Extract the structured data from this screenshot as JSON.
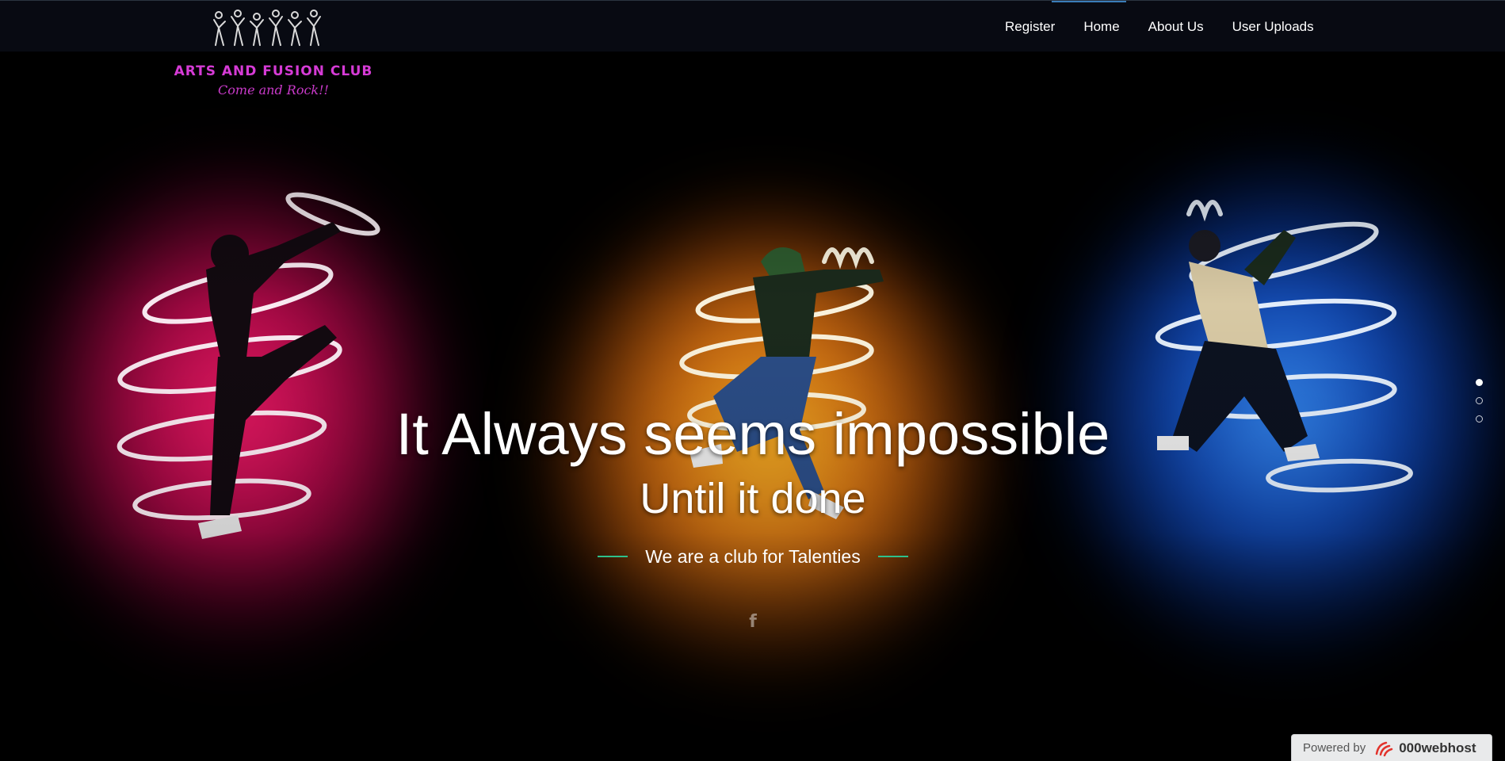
{
  "brand": {
    "title": "ARTS AND FUSION CLUB",
    "subtitle": "Come and Rock!!"
  },
  "nav": {
    "items": [
      {
        "label": "Register"
      },
      {
        "label": "Home"
      },
      {
        "label": "About Us"
      },
      {
        "label": "User Uploads"
      }
    ],
    "active": "Home"
  },
  "hero": {
    "line1": "It Always seems impossible",
    "line2": "Until it done",
    "tagline": "We are a club for Talenties",
    "social_icon": "f"
  },
  "slider": {
    "slides": 3,
    "active_index": 0
  },
  "footer_badge": {
    "label": "Powered by",
    "brand": "000webhost"
  },
  "icons": {
    "logo": "dancers-logo-icon",
    "facebook": "facebook-icon",
    "host_logo": "webhost-logo-icon"
  },
  "colors": {
    "brand_magenta": "#d63bd6",
    "accent_green": "#2ec08a",
    "glow_pink": "#ff1e6e",
    "glow_orange": "#ffa020",
    "glow_blue": "#3c96ff",
    "header_bg": "#080a12"
  }
}
